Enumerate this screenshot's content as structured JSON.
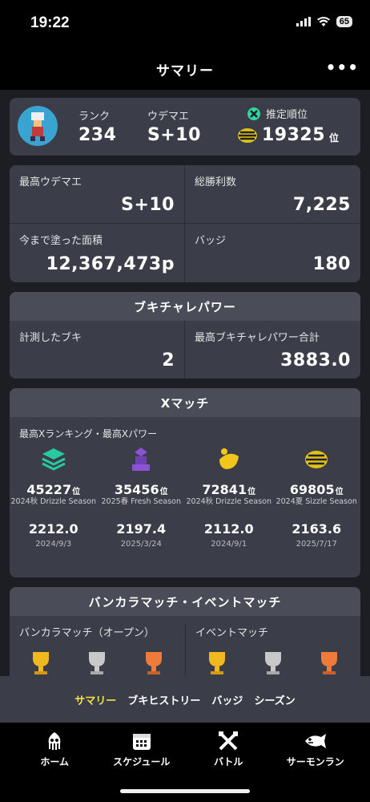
{
  "status": {
    "time": "19:22",
    "battery": "65"
  },
  "header": {
    "title": "サマリー",
    "more": "•••"
  },
  "profile": {
    "rank_label": "ランク",
    "rank_value": "234",
    "udemae_label": "ウデマエ",
    "udemae_value": "S+10",
    "est_label": "推定順位",
    "est_value": "19325",
    "est_unit": "位"
  },
  "stats": {
    "max_udemae_label": "最高ウデマエ",
    "max_udemae_value": "S+10",
    "wins_label": "総勝利数",
    "wins_value": "7,225",
    "painted_label": "今まで塗った面積",
    "painted_value": "12,367,473p",
    "badges_label": "バッジ",
    "badges_value": "180"
  },
  "bukichi": {
    "title": "ブキチャレパワー",
    "measured_label": "計測したブキ",
    "measured_value": "2",
    "max_label": "最高ブキチャレパワー合計",
    "max_value": "3883.0"
  },
  "xmatch": {
    "title": "Xマッチ",
    "subtitle": "最高Xランキング・最高Xパワー",
    "rank_unit": "位",
    "entries": [
      {
        "rank": "45227",
        "season": "2024秋 Drizzle Season",
        "power": "2212.0",
        "date": "2024/9/3",
        "icon": "splat-zones-icon"
      },
      {
        "rank": "35456",
        "season": "2025春 Fresh Season",
        "power": "2197.4",
        "date": "2025/3/24",
        "icon": "tower-control-icon"
      },
      {
        "rank": "72841",
        "season": "2024秋 Drizzle Season",
        "power": "2112.0",
        "date": "2024/9/1",
        "icon": "rainmaker-icon"
      },
      {
        "rank": "69805",
        "season": "2024夏 Sizzle Season",
        "power": "2163.6",
        "date": "2025/7/17",
        "icon": "clam-blitz-icon"
      }
    ]
  },
  "bankara": {
    "title": "バンカラマッチ・イベントマッチ",
    "open_label": "バンカラマッチ（オープン）",
    "event_label": "イベントマッチ"
  },
  "sub_tabs": [
    "サマリー",
    "ブキヒストリー",
    "バッジ",
    "シーズン"
  ],
  "bottom_nav": [
    "ホーム",
    "スケジュール",
    "バトル",
    "サーモンラン"
  ],
  "colors": {
    "accent_yellow": "#f6e14a",
    "card": "#3b3d48",
    "background": "#1d1e24"
  }
}
